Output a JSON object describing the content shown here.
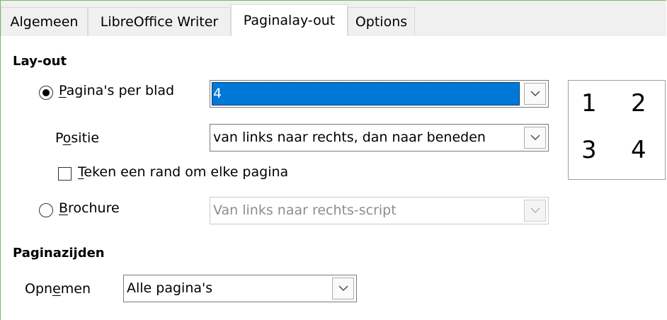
{
  "tabs": [
    {
      "label": "Algemeen"
    },
    {
      "label": "LibreOffice Writer"
    },
    {
      "label": "Paginalay-out"
    },
    {
      "label": "Options"
    }
  ],
  "layout": {
    "heading": "Lay-out",
    "pages_per_sheet": {
      "mnemonic": "P",
      "rest": "agina's per blad",
      "value": "4",
      "selected": true
    },
    "position": {
      "label_pre": "P",
      "mnemonic": "o",
      "label_post": "sitie",
      "value": "van links naar rechts, dan naar beneden"
    },
    "border": {
      "mnemonic": "T",
      "rest": "eken een rand om elke pagina",
      "checked": false
    },
    "brochure": {
      "mnemonic": "B",
      "rest": "rochure",
      "value": "Van links naar rechts-script",
      "selected": false
    },
    "preview": {
      "numbers": [
        "1",
        "2",
        "3",
        "4"
      ]
    }
  },
  "sides": {
    "heading": "Paginazijden",
    "include": {
      "label_pre": "Opn",
      "mnemonic": "e",
      "label_post": "men",
      "value": "Alle pagina's"
    }
  }
}
